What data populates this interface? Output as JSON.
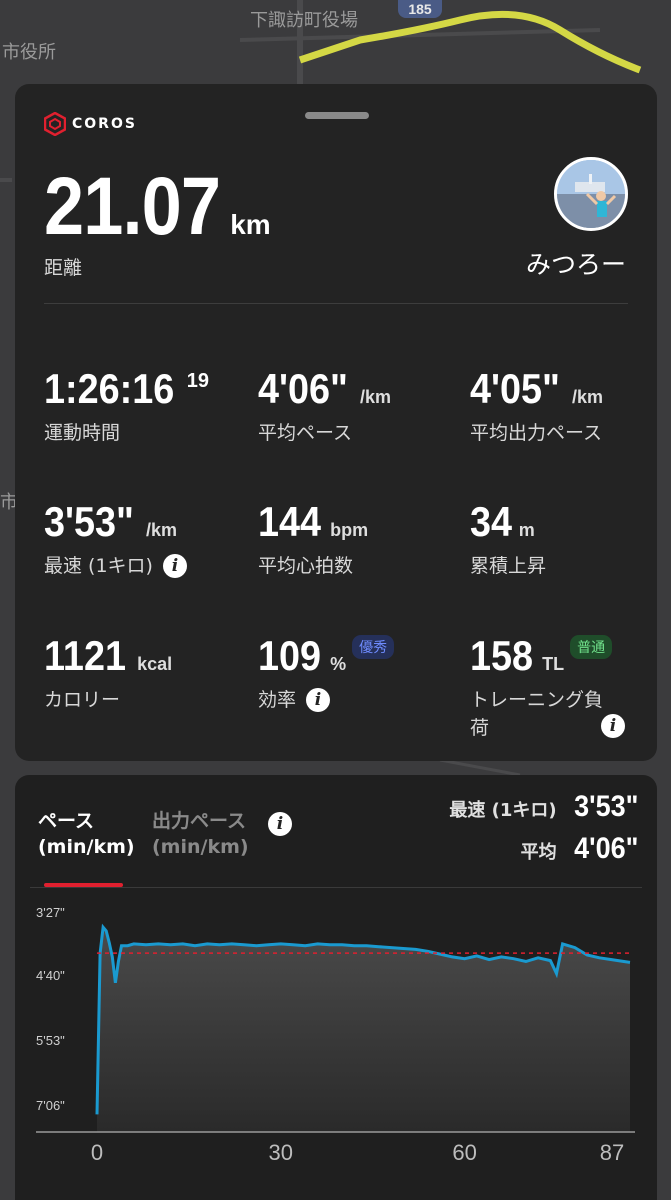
{
  "map": {
    "labels": [
      "下諏訪町役場",
      "市役所",
      "市"
    ],
    "route_number": "185"
  },
  "brand": {
    "logo_text": "COROS"
  },
  "summary": {
    "distance_value": "21.07",
    "distance_unit": "km",
    "distance_label": "距離",
    "username": "みつろー"
  },
  "stats": [
    {
      "value": "1:26:16",
      "sup": "19",
      "unit": "",
      "label": "運動時間"
    },
    {
      "value": "4'06\"",
      "unit": "/km",
      "label": "平均ペース"
    },
    {
      "value": "4'05\"",
      "unit": "/km",
      "label": "平均出力ペース"
    },
    {
      "value": "3'53\"",
      "unit": "/km",
      "label": "最速 (1キロ)"
    },
    {
      "value": "144",
      "unit": "bpm",
      "label": "平均心拍数"
    },
    {
      "value": "34",
      "unit": "m",
      "label": "累積上昇"
    },
    {
      "value": "1121",
      "unit": "kcal",
      "label": "カロリー"
    },
    {
      "value": "109",
      "unit": "%",
      "label": "効率",
      "badge": "優秀"
    },
    {
      "value": "158",
      "unit": "TL",
      "label": "トレーニング負荷",
      "badge": "普通"
    }
  ],
  "colors": {
    "badge_excellent_bg": "#25305a",
    "badge_excellent_fg": "#6f8cff",
    "badge_normal_bg": "#1f4d2a",
    "badge_normal_fg": "#6fe08a",
    "accent_red": "#e0202f"
  },
  "chart_tabs": {
    "pace_label": "ペース\n(min/km)",
    "power_pace_label": "出力ペース\n(min/km)"
  },
  "chart_summary": {
    "best_key": "最速 (1キロ)",
    "best_value": "3'53\"",
    "avg_key": "平均",
    "avg_value": "4'06\""
  },
  "chart_data": {
    "type": "area",
    "xlabel": "",
    "ylabel": "",
    "x_ticks": [
      "0",
      "30",
      "60",
      "87"
    ],
    "y_ticks": [
      "3'27\"",
      "4'40\"",
      "5'53\"",
      "7'06\""
    ],
    "x_range": [
      0,
      87
    ],
    "y_range_seconds": [
      207,
      426
    ],
    "y_inverted": true,
    "average_line_seconds": 246,
    "series": [
      {
        "x": [
          0,
          0.5,
          1,
          1.5,
          2,
          2.5,
          3,
          3.5,
          4,
          5,
          6,
          8,
          10,
          12,
          14,
          16,
          18,
          20,
          22,
          24,
          26,
          28,
          30,
          32,
          34,
          36,
          38,
          40,
          42,
          44,
          46,
          48,
          50,
          52,
          54,
          56,
          58,
          60,
          62,
          64,
          66,
          68,
          70,
          72,
          74,
          75,
          76,
          78,
          80,
          82,
          84,
          86,
          87
        ],
        "values": [
          420,
          246,
          218,
          222,
          235,
          250,
          278,
          255,
          238,
          238,
          236,
          237,
          236,
          237,
          236,
          238,
          236,
          237,
          236,
          237,
          238,
          237,
          236,
          237,
          238,
          236,
          237,
          237,
          238,
          238,
          239,
          240,
          241,
          242,
          244,
          247,
          250,
          252,
          249,
          253,
          250,
          252,
          255,
          251,
          254,
          268,
          236,
          240,
          248,
          251,
          253,
          255,
          256
        ]
      }
    ]
  }
}
